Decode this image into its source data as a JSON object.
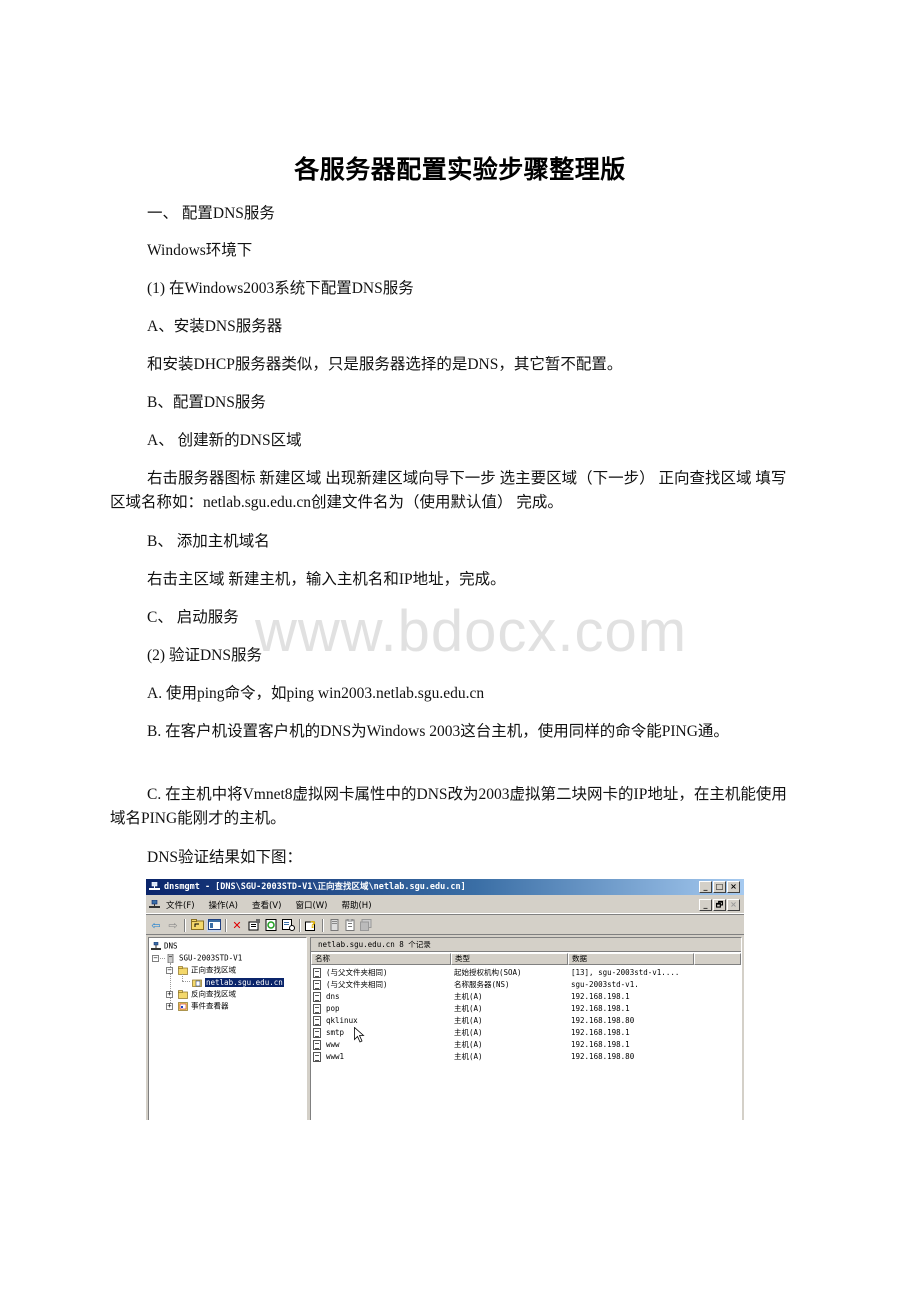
{
  "document": {
    "title": "各服务器配置实验步骤整理版",
    "watermark": "www.bdocx.com",
    "paragraphs": [
      "一、 配置DNS服务",
      "Windows环境下",
      "(1) 在Windows2003系统下配置DNS服务",
      "A、安装DNS服务器",
      "和安装DHCP服务器类似，只是服务器选择的是DNS，其它暂不配置。",
      "B、配置DNS服务",
      "A、 创建新的DNS区域",
      "右击服务器图标 新建区域 出现新建区域向导下一步 选主要区域（下一步） 正向查找区域 填写区域名称如：netlab.sgu.edu.cn创建文件名为（使用默认值） 完成。",
      "B、 添加主机域名",
      "右击主区域 新建主机，输入主机名和IP地址，完成。",
      "C、 启动服务",
      "(2) 验证DNS服务",
      "A.  使用ping命令，如ping win2003.netlab.sgu.edu.cn",
      "B. 在客户机设置客户机的DNS为Windows 2003这台主机，使用同样的命令能PING通。",
      "C. 在主机中将Vmnet8虚拟网卡属性中的DNS改为2003虚拟第二块网卡的IP地址，在主机能使用域名PING能刚才的主机。",
      "DNS验证结果如下图："
    ]
  },
  "screenshot": {
    "window_title": "dnsmgmt - [DNS\\SGU-2003STD-V1\\正向查找区域\\netlab.sgu.edu.cn]",
    "window_buttons": [
      "_",
      "□",
      "×"
    ],
    "child_buttons": [
      "_",
      "🗗",
      "×"
    ],
    "menu": [
      "文件(F)",
      "操作(A)",
      "查看(V)",
      "窗口(W)",
      "帮助(H)"
    ],
    "toolbar_icons": [
      "back-icon",
      "forward-icon",
      "up-folder-icon",
      "show-tree-icon",
      "delete-icon",
      "properties-icon",
      "refresh-icon",
      "export-icon",
      "help-icon",
      "server-icon",
      "record-icon",
      "zone-icon"
    ],
    "tree": {
      "root": "DNS",
      "server": "SGU-2003STD-V1",
      "forward_zones": "正向查找区域",
      "selected_zone": "netlab.sgu.edu.cn",
      "reverse_zones": "反向查找区域",
      "event_viewer": "事件查看器"
    },
    "list_header": "netlab.sgu.edu.cn    8 个记录",
    "columns": [
      "名称",
      "类型",
      "数据"
    ],
    "records": [
      {
        "name": "(与父文件夹相同)",
        "type": "起始授权机构(SOA)",
        "data": "[13], sgu-2003std-v1...."
      },
      {
        "name": "(与父文件夹相同)",
        "type": "名称服务器(NS)",
        "data": "sgu-2003std-v1."
      },
      {
        "name": "dns",
        "type": "主机(A)",
        "data": "192.168.198.1"
      },
      {
        "name": "pop",
        "type": "主机(A)",
        "data": "192.168.198.1"
      },
      {
        "name": "qklinux",
        "type": "主机(A)",
        "data": "192.168.198.80"
      },
      {
        "name": "smtp",
        "type": "主机(A)",
        "data": "192.168.198.1"
      },
      {
        "name": "www",
        "type": "主机(A)",
        "data": "192.168.198.1"
      },
      {
        "name": "www1",
        "type": "主机(A)",
        "data": "192.168.198.80"
      }
    ]
  }
}
